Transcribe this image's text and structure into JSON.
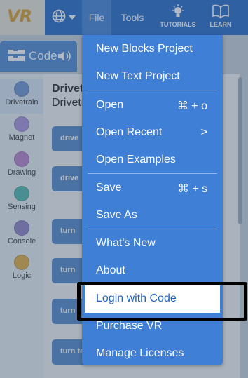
{
  "app": {
    "logo_text": "VR"
  },
  "topbar": {
    "file_label": "File",
    "tools_label": "Tools",
    "tutorials_label": "TUTORIALS",
    "learn_label": "LEARN"
  },
  "code_tab": {
    "label": "Code"
  },
  "palette": {
    "categories": [
      {
        "label": "Drivetrain",
        "color": "#6a8fd0"
      },
      {
        "label": "Magnet",
        "color": "#a58fd9"
      },
      {
        "label": "Drawing",
        "color": "#b77cc9"
      },
      {
        "label": "Sensing",
        "color": "#4db3a6"
      },
      {
        "label": "Console",
        "color": "#8d7cc2"
      },
      {
        "label": "Logic",
        "color": "#e0a93b"
      }
    ]
  },
  "flyout": {
    "title": "Drivetrain",
    "subtitle": "Drivetrain",
    "blocks": [
      "drive",
      "drive",
      "turn",
      "turn",
      "turn",
      "turn to"
    ]
  },
  "file_menu": {
    "items": [
      {
        "label": "New Blocks Project",
        "shortcut": ""
      },
      {
        "label": "New Text Project",
        "shortcut": ""
      },
      {
        "label": "Open",
        "shortcut": "⌘ + o"
      },
      {
        "label": "Open Recent",
        "shortcut": ">"
      },
      {
        "label": "Open Examples",
        "shortcut": ""
      },
      {
        "label": "Save",
        "shortcut": "⌘ + s"
      },
      {
        "label": "Save As",
        "shortcut": ""
      },
      {
        "label": "What's New",
        "shortcut": ""
      },
      {
        "label": "About",
        "shortcut": ""
      },
      {
        "label": "Login with Code",
        "shortcut": ""
      },
      {
        "label": "Purchase VR",
        "shortcut": ""
      },
      {
        "label": "Manage Licenses",
        "shortcut": ""
      }
    ]
  }
}
